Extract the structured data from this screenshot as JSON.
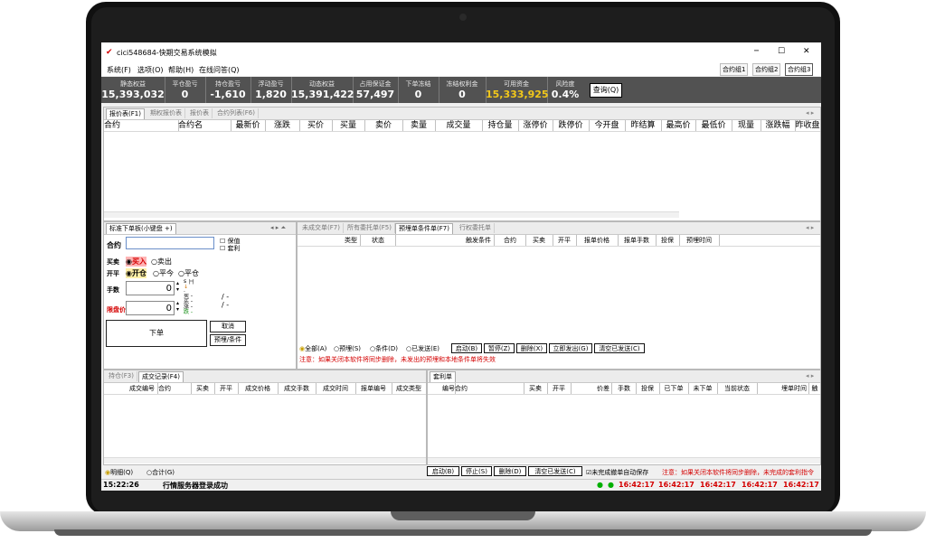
{
  "window": {
    "title": "cici548684-快期交易系统模拟",
    "min": "─",
    "max": "☐",
    "close": "✕"
  },
  "menu": [
    "系统(F)",
    "选项(O)",
    "帮助(H)",
    "在线问答(Q)"
  ],
  "contract_groups": [
    "合约组1",
    "合约组2",
    "合约组3"
  ],
  "stats": [
    {
      "label": "静态权益",
      "value": "15,393,032"
    },
    {
      "label": "平仓盈亏",
      "value": "0"
    },
    {
      "label": "持仓盈亏",
      "value": "-1,610"
    },
    {
      "label": "浮动盈亏",
      "value": "1,820"
    },
    {
      "label": "动态权益",
      "value": "15,391,422"
    },
    {
      "label": "占用保证金",
      "value": "57,497"
    },
    {
      "label": "下单冻结",
      "value": "0"
    },
    {
      "label": "冻结权利金",
      "value": "0"
    },
    {
      "label": "可用资金",
      "value": "15,333,925"
    },
    {
      "label": "风险度",
      "value": "0.4%"
    }
  ],
  "query_button": "查询(Q)",
  "quote_tabs": [
    "报价表(F1)",
    "期权报价表",
    "报价表",
    "合约列表(F6)"
  ],
  "quote_columns": [
    "合约",
    "合约名",
    "最新价",
    "涨跌",
    "买价",
    "买量",
    "卖价",
    "卖量",
    "成交量",
    "持仓量",
    "涨停价",
    "跌停价",
    "今开盘",
    "昨结算",
    "最高价",
    "最低价",
    "现量",
    "涨跌幅",
    "昨收盘"
  ],
  "order_panel": {
    "tab": "标准下单板(小键盘 +)",
    "contract_label": "合约",
    "contract_value": "",
    "check_protect": "保值",
    "check_arb": "套利",
    "direction_label": "买卖",
    "buy": "买入",
    "sell": "卖出",
    "offset_label": "开平",
    "open": "开仓",
    "close_today": "平今",
    "close": "平仓",
    "qty_label": "手数",
    "qty_value": "0",
    "price_label": "限盘价",
    "price_value": "0",
    "order_button": "下单",
    "cancel_button": "取消",
    "preorder_button": "预埋/条件"
  },
  "pending_tabs": [
    "未成交单(F7)",
    "所有委托单(F5)",
    "预埋单条件单(F7)",
    "行权委托单"
  ],
  "pending_columns": [
    "类型",
    "状态",
    "触发条件",
    "合约",
    "买卖",
    "开平",
    "报单价格",
    "报单手数",
    "投保",
    "预埋时间"
  ],
  "pending_controls": {
    "radios": [
      "全部(A)",
      "预埋(S)",
      "条件(D)",
      "已发送(E)"
    ],
    "buttons": [
      "启动(B)",
      "暂停(Z)",
      "删除(X)",
      "立即发出(G)",
      "清空已发送(C)"
    ],
    "note": "注意：如果关闭本软件将同步删除，未发出的预埋和本地条件单将失效"
  },
  "trade_tabs": [
    "持仓(F3)",
    "成交记录(F4)"
  ],
  "trade_columns": [
    "成交编号",
    "合约",
    "买卖",
    "开平",
    "成交价格",
    "成交手数",
    "成交时间",
    "报单编号",
    "成交类型"
  ],
  "cond_tab": "套利单",
  "cond_columns": [
    "编号",
    "合约",
    "买卖",
    "开平",
    "价差",
    "手数",
    "投保",
    "已下单",
    "未下单",
    "当前状态",
    "埋单时间",
    "触"
  ],
  "bottom": {
    "detail": "明细(Q)",
    "total": "合计(G)",
    "buttons": [
      "启动(B)",
      "停止(S)",
      "删除(D)",
      "清空已发送(C)"
    ],
    "auto_check": "未完成撤单自动保存",
    "note": "注意：如果关闭本软件将同步删除，未完成的套利指令"
  },
  "status": {
    "time": "15:22:26",
    "message": "行情服务器登录成功",
    "clocks": [
      "16:42:17",
      "16:42:17",
      "16:42:17",
      "16:42:17",
      "16:42:17"
    ]
  },
  "colors": {
    "stats_bg": "#525252",
    "available_funds": "#f2c81a",
    "alert": "#d40000",
    "status_ok": "#00b000"
  }
}
